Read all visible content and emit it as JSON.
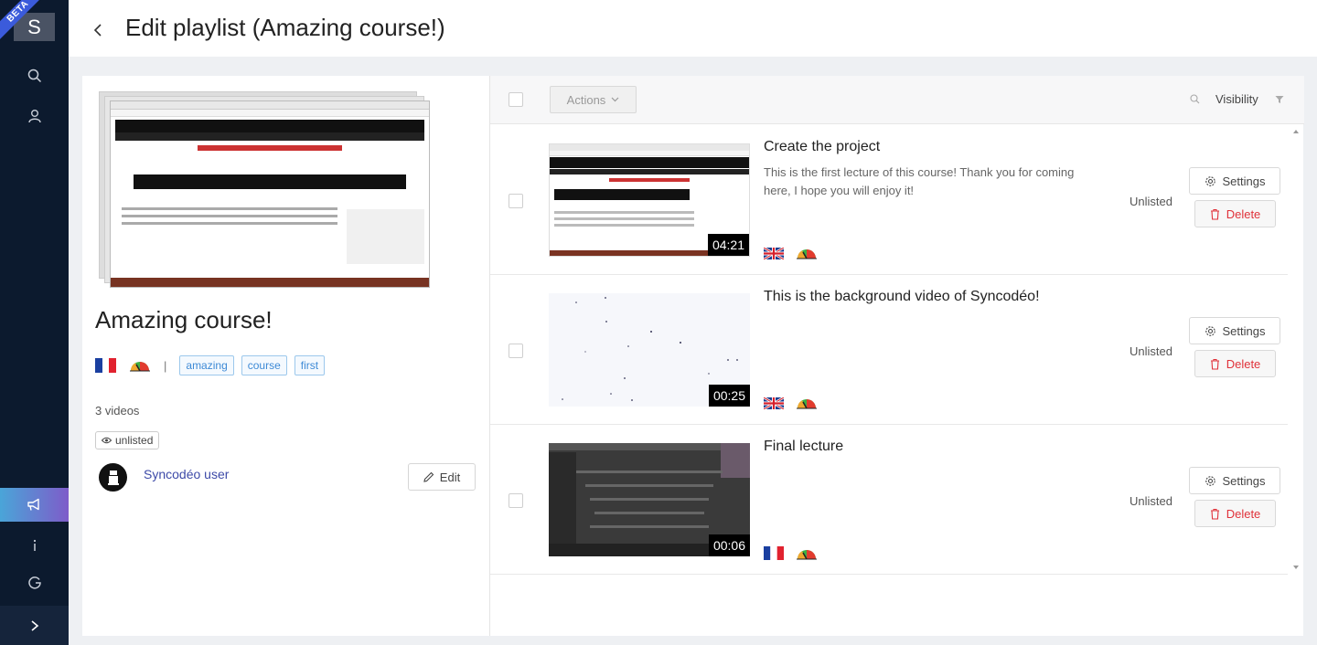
{
  "sidebar": {
    "logo_letter": "S",
    "beta_label": "BETA",
    "items": [
      {
        "icon": "search-icon"
      },
      {
        "icon": "user-icon"
      },
      {
        "icon": "megaphone-icon"
      },
      {
        "icon": "info-icon"
      },
      {
        "icon": "logout-icon"
      },
      {
        "icon": "chevron-right-icon"
      }
    ]
  },
  "header": {
    "title": "Edit playlist (Amazing course!)"
  },
  "playlist": {
    "title": "Amazing course!",
    "tags": [
      "amazing",
      "course",
      "first"
    ],
    "separator": "|",
    "video_count": "3 videos",
    "visibility": "unlisted",
    "user_name": "Syncodéo user",
    "edit_label": "Edit"
  },
  "toolbar": {
    "actions_label": "Actions",
    "visibility_label": "Visibility"
  },
  "videos": [
    {
      "title": "Create the project",
      "description": "This is the first lecture of this course! Thank you for coming here, I hope you will enjoy it!",
      "duration": "04:21",
      "language": "uk-flag-icon",
      "status": "Unlisted",
      "settings_label": "Settings",
      "delete_label": "Delete"
    },
    {
      "title": "This is the background video of Syncodéo!",
      "description": "",
      "duration": "00:25",
      "language": "uk-flag-icon",
      "status": "Unlisted",
      "settings_label": "Settings",
      "delete_label": "Delete"
    },
    {
      "title": "Final lecture",
      "description": "",
      "duration": "00:06",
      "language": "france-flag-icon",
      "status": "Unlisted",
      "settings_label": "Settings",
      "delete_label": "Delete"
    }
  ],
  "colors": {
    "sidebar_bg": "#0c1a2e",
    "accent_blue": "#3d4aa8",
    "delete_red": "#e0323a",
    "tag_blue": "#3e8ad6"
  }
}
